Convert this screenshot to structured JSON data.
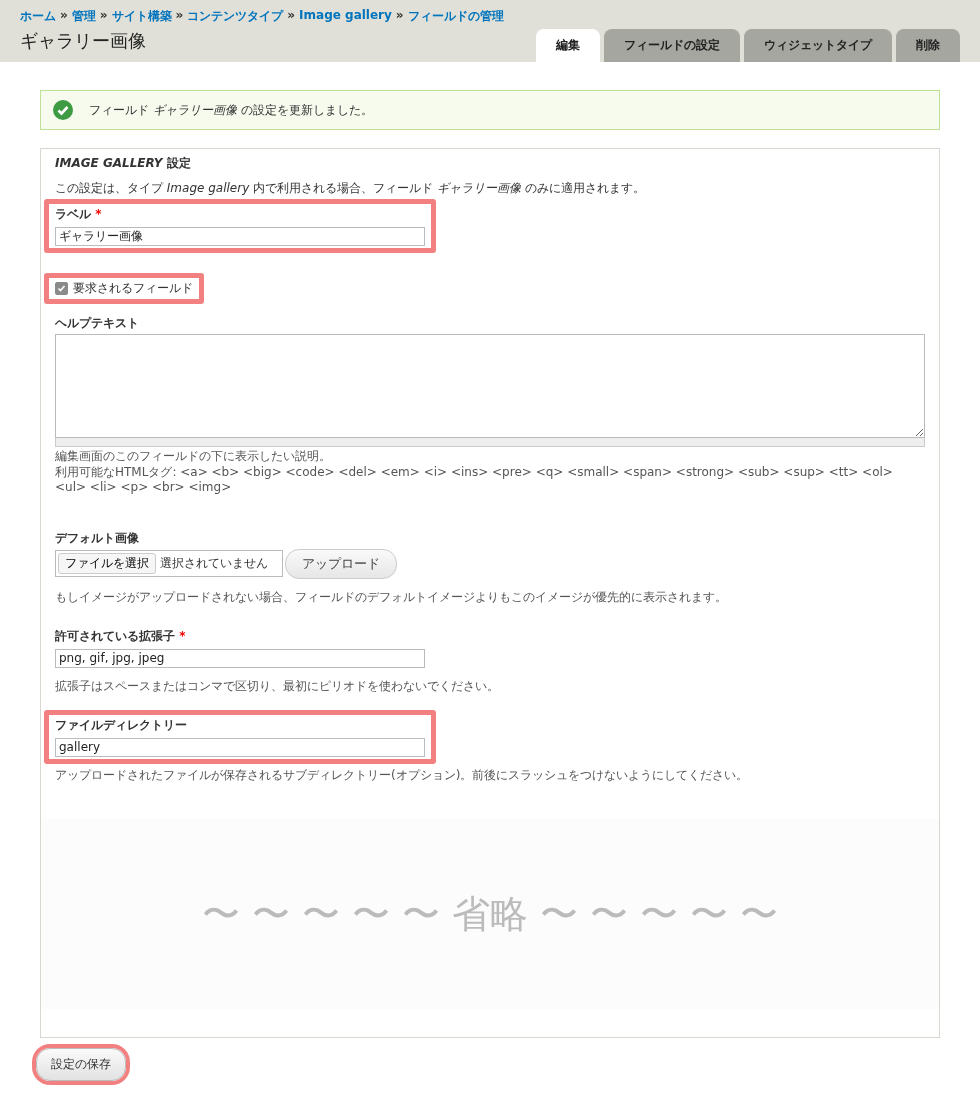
{
  "breadcrumbs": [
    "ホーム",
    "管理",
    "サイト構築",
    "コンテンツタイプ",
    "Image gallery",
    "フィールドの管理"
  ],
  "breadcrumb_separator": "»",
  "page_title": "ギャラリー画像",
  "tabs": [
    {
      "label": "編集",
      "selected": true
    },
    {
      "label": "フィールドの設定",
      "selected": false
    },
    {
      "label": "ウィジェットタイプ",
      "selected": false
    },
    {
      "label": "削除",
      "selected": false
    }
  ],
  "status_message": {
    "kind": "success",
    "text": "フィールド *ギャラリー画像* の設定を更新しました。"
  },
  "fieldset": {
    "legend": "*IMAGE GALLERY* 設定",
    "intro": "この設定は、タイプ *Image gallery* 内で利用される場合、フィールド *ギャラリー画像* のみに適用されます。",
    "fields": [
      {
        "kind": "text",
        "label": "ラベル",
        "required_mark": "*",
        "value": "ギャラリー画像",
        "highlighted": true
      },
      {
        "kind": "checkbox",
        "label": "要求されるフィールド",
        "checked": true,
        "highlighted": true
      },
      {
        "kind": "textarea",
        "label": "ヘルプテキスト",
        "highlighted": false,
        "description": "編集画面のこのフィールドの下に表示したい説明。",
        "description_2": "利用可能なHTMLタグ: <a> <b> <big> <code> <del> <em> <i> <ins> <pre> <q> <small> <span> <strong> <sub> <sup> <tt> <ol> <ul> <li> <p> <br> <img>"
      },
      {
        "kind": "file",
        "label": "デフォルト画像",
        "highlighted": false,
        "choose_button": "ファイルを選択",
        "file_status": "選択されていません",
        "upload_button": "アップロード",
        "description": "もしイメージがアップロードされない場合、フィールドのデフォルトイメージよりもこのイメージが優先的に表示されます。"
      },
      {
        "kind": "text",
        "label": "許可されている拡張子",
        "required_mark": "*",
        "value": "png, gif, jpg, jpeg",
        "highlighted": false,
        "description": "拡張子はスペースまたはコンマで区切り、最初にピリオドを使わないでください。"
      },
      {
        "kind": "text",
        "label": "ファイルディレクトリー",
        "value": "gallery",
        "highlighted": true,
        "description": "アップロードされたファイルが保存されるサブディレクトリー(オプション)。前後にスラッシュをつけないようにしてください。"
      }
    ],
    "omission_text": "〜 〜 〜 〜 〜 省略 〜 〜 〜 〜 〜"
  },
  "save_button": {
    "label": "設定の保存",
    "highlighted": true
  }
}
